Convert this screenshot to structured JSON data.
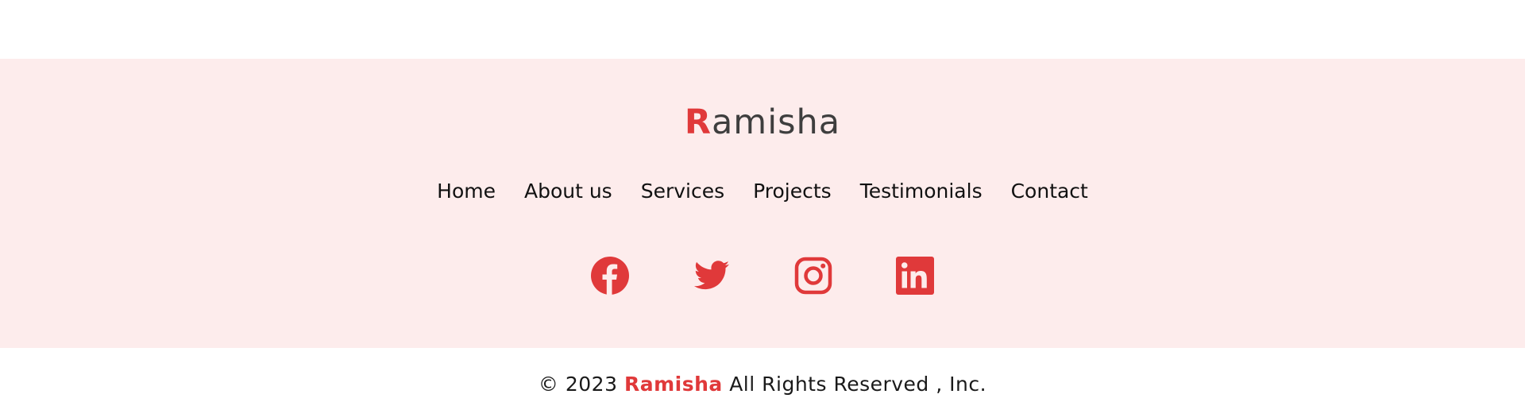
{
  "colors": {
    "accent": "#e0393a",
    "band_background": "#fdecec",
    "text": "#111111"
  },
  "brand": {
    "first_letter": "R",
    "rest": "amisha"
  },
  "nav": {
    "items": [
      {
        "label": "Home"
      },
      {
        "label": "About us"
      },
      {
        "label": "Services"
      },
      {
        "label": "Projects"
      },
      {
        "label": "Testimonials"
      },
      {
        "label": "Contact"
      }
    ]
  },
  "socials": [
    {
      "icon": "facebook-icon"
    },
    {
      "icon": "twitter-icon"
    },
    {
      "icon": "instagram-icon"
    },
    {
      "icon": "linkedin-icon"
    }
  ],
  "copyright": {
    "prefix": "© 2023",
    "brand": "Ramisha",
    "suffix": "All Rights Reserved , Inc."
  }
}
